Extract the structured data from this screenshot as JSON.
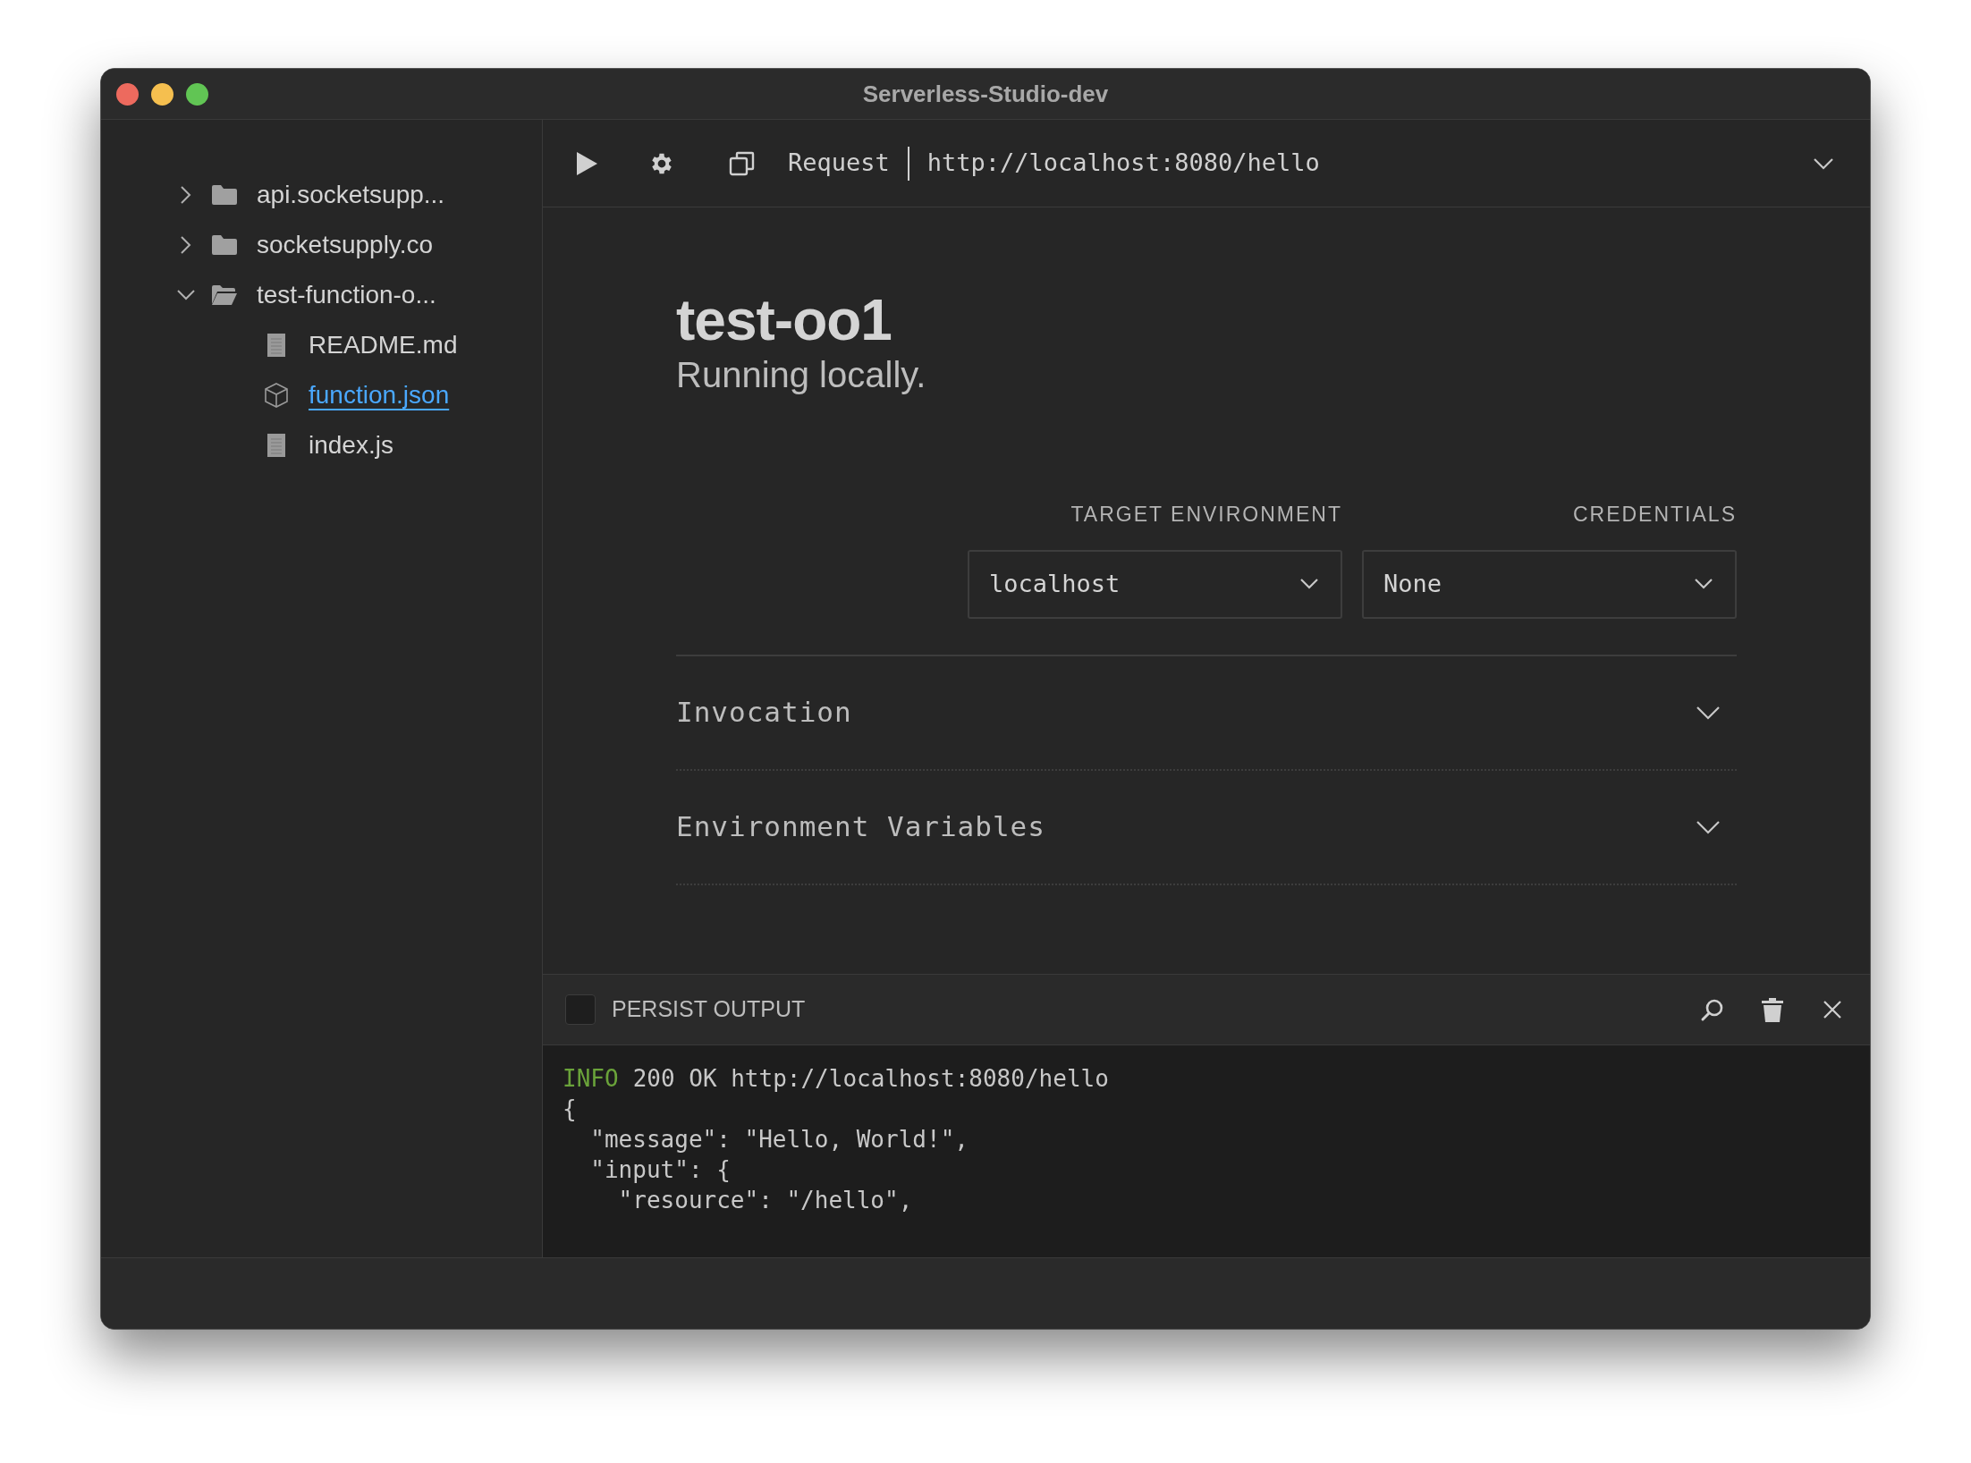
{
  "window": {
    "title": "Serverless-Studio-dev"
  },
  "sidebar": {
    "tree": [
      {
        "label": "api.socketsupp...",
        "kind": "folder",
        "expanded": false,
        "selected": false
      },
      {
        "label": "socketsupply.co",
        "kind": "folder",
        "expanded": false,
        "selected": false
      },
      {
        "label": "test-function-o...",
        "kind": "folder",
        "expanded": true,
        "selected": false,
        "children": [
          {
            "label": "README.md",
            "kind": "file",
            "selected": false
          },
          {
            "label": "function.json",
            "kind": "package",
            "selected": true
          },
          {
            "label": "index.js",
            "kind": "file",
            "selected": false
          }
        ]
      }
    ]
  },
  "toolbar": {
    "request_label": "Request",
    "url": "http://localhost:8080/hello"
  },
  "function": {
    "title": "test-oo1",
    "subtitle": "Running locally."
  },
  "selects": [
    {
      "label": "TARGET ENVIRONMENT",
      "value": "localhost"
    },
    {
      "label": "CREDENTIALS",
      "value": "None"
    }
  ],
  "sections": [
    {
      "title": "Invocation",
      "expanded": false
    },
    {
      "title": "Environment Variables",
      "expanded": false
    }
  ],
  "output": {
    "persist_label": "PERSIST OUTPUT",
    "persist_checked": false,
    "lines": [
      {
        "level": "INFO",
        "text": "200 OK http://localhost:8080/hello"
      },
      {
        "text": "{"
      },
      {
        "text": "  \"message\": \"Hello, World!\","
      },
      {
        "text": "  \"input\": {"
      },
      {
        "text": "    \"resource\": \"/hello\","
      }
    ]
  }
}
